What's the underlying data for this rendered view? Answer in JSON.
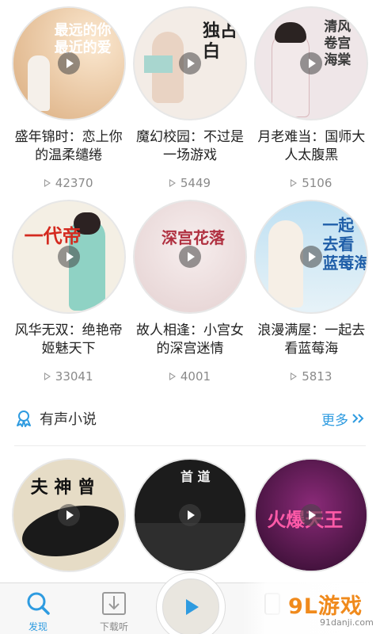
{
  "grid_rows": [
    [
      {
        "title": "盛年锦时：恋上你的温柔缱绻",
        "count": "42370",
        "cover_text": "最远的你\n最近的爱",
        "cover_bg": "#e8c9a4",
        "cover_text_color": "#ffffff"
      },
      {
        "title": "魔幻校园：不过是一场游戏",
        "count": "5449",
        "cover_text": "独占\n白",
        "cover_bg": "#f3ece6",
        "cover_text_color": "#222222"
      },
      {
        "title": "月老难当：国师大人太腹黑",
        "count": "5106",
        "cover_text": "清风\n卷宫海棠",
        "cover_bg": "#efe6e8",
        "cover_text_color": "#3a3a3a"
      }
    ],
    [
      {
        "title": "风华无双：绝艳帝姬魅天下",
        "count": "33041",
        "cover_text": "一代帝",
        "cover_bg": "#f4efe4",
        "cover_text_color": "#d42a1f"
      },
      {
        "title": "故人相逢：小宫女的深宫迷情",
        "count": "4001",
        "cover_text": "深宫花落",
        "cover_bg": "#efe4e4",
        "cover_text_color": "#b03040"
      },
      {
        "title": "浪漫满屋：一起去看蓝莓海",
        "count": "5813",
        "cover_text": "一起\n去看\n蓝莓海",
        "cover_bg": "#cfe6f2",
        "cover_text_color": "#1f5ea8"
      }
    ],
    [
      {
        "title": "",
        "count": "",
        "cover_text": "夫 神 曾",
        "cover_bg": "#e6dcc6",
        "cover_text_color": "#111111"
      },
      {
        "title": "",
        "count": "",
        "cover_text": "首 道",
        "cover_bg": "#1c1c1c",
        "cover_text_color": "#f2f2f2"
      },
      {
        "title": "",
        "count": "",
        "cover_text": "火爆天王",
        "cover_bg": "#3b0f3a",
        "cover_text_color": "#ff5aa8"
      }
    ]
  ],
  "section": {
    "title": "有声小说",
    "more": "更多"
  },
  "bottom_nav": {
    "discover": "发现",
    "downloads": "下载听"
  },
  "watermark": {
    "logo": "9L游戏",
    "url": "91danji.com"
  },
  "colors": {
    "accent": "#2e9be0"
  }
}
